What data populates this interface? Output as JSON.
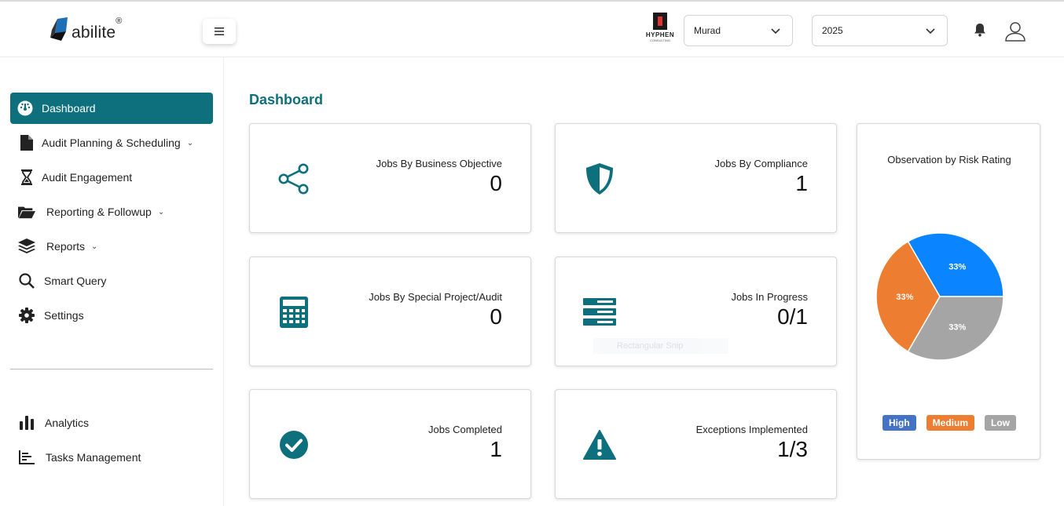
{
  "header": {
    "logo_text": "abilite",
    "logo_reg": "®",
    "partner_logo_text": "HYPHEN",
    "partner_logo_subtext": "CONSULTING",
    "company_select": {
      "value": "Murad"
    },
    "year_select": {
      "value": "2025"
    }
  },
  "sidebar": {
    "items": [
      {
        "label": "Dashboard",
        "icon": "dashboard-gauge-icon"
      },
      {
        "label": "Audit Planning & Scheduling",
        "icon": "file-icon"
      },
      {
        "label": "Audit Engagement",
        "icon": "hourglass-icon"
      },
      {
        "label": "Reporting & Followup",
        "icon": "folder-open-icon"
      },
      {
        "label": "Reports",
        "icon": "layers-icon"
      },
      {
        "label": "Smart Query",
        "icon": "search-icon"
      },
      {
        "label": "Settings",
        "icon": "gear-icon"
      }
    ],
    "bottom_items": [
      {
        "label": "Analytics",
        "icon": "bar-chart-icon"
      },
      {
        "label": "Tasks Management",
        "icon": "list-chart-icon"
      }
    ]
  },
  "main": {
    "title": "Dashboard",
    "cards": [
      {
        "label": "Jobs By Business Objective",
        "value": "0",
        "icon": "share-icon"
      },
      {
        "label": "Jobs By Compliance",
        "value": "1",
        "icon": "shield-icon"
      },
      {
        "label": "Jobs By Special Project/Audit",
        "value": "0",
        "icon": "calculator-icon"
      },
      {
        "label": "Jobs In Progress",
        "value": "0/1",
        "icon": "server-icon"
      },
      {
        "label": "Jobs Completed",
        "value": "1",
        "icon": "check-circle-icon"
      },
      {
        "label": "Exceptions Implemented",
        "value": "1/3",
        "icon": "warning-icon"
      }
    ],
    "ghost_text": "Rectangular Snip"
  },
  "chart_data": {
    "type": "pie",
    "title": "Observation by Risk Rating",
    "categories": [
      "High",
      "Medium",
      "Low"
    ],
    "values": [
      33.33,
      33.33,
      33.33
    ],
    "labels": [
      "33%",
      "33%",
      "33%"
    ],
    "colors": [
      "#0a84ff",
      "#ed7d31",
      "#a5a5a5"
    ],
    "legend": [
      {
        "label": "High",
        "color": "#4472c4"
      },
      {
        "label": "Medium",
        "color": "#ed7d31"
      },
      {
        "label": "Low",
        "color": "#a5a5a5"
      }
    ],
    "legend_position": "bottom"
  },
  "colors": {
    "accent": "#0e6f7d"
  }
}
